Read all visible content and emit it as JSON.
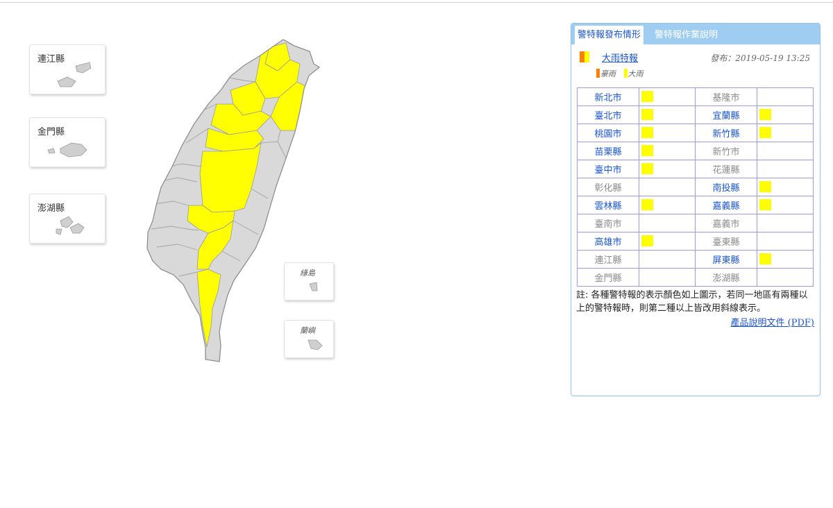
{
  "insets": [
    {
      "id": "lienchiang",
      "label": "連江縣"
    },
    {
      "id": "kinmen",
      "label": "金門縣"
    },
    {
      "id": "penghu",
      "label": "澎湖縣"
    },
    {
      "id": "green-island",
      "label": "綠島"
    },
    {
      "id": "orchid-island",
      "label": "蘭嶼"
    }
  ],
  "panel": {
    "tabs": [
      {
        "label": "警特報發布情形",
        "active": true
      },
      {
        "label": "警特報作業說明",
        "active": false
      }
    ],
    "warning_link": "大雨特報",
    "issued": "發布：2019-05-19 13:25",
    "legend": [
      {
        "label": "豪雨",
        "color": "#ff7f00"
      },
      {
        "label": "大雨",
        "color": "#ffff00"
      }
    ],
    "rows": [
      [
        {
          "name": "新北市",
          "warn": true
        },
        {
          "name": "基隆市",
          "warn": false
        }
      ],
      [
        {
          "name": "臺北市",
          "warn": true
        },
        {
          "name": "宜蘭縣",
          "warn": true
        }
      ],
      [
        {
          "name": "桃園市",
          "warn": true
        },
        {
          "name": "新竹縣",
          "warn": true
        }
      ],
      [
        {
          "name": "苗栗縣",
          "warn": true
        },
        {
          "name": "新竹市",
          "warn": false
        }
      ],
      [
        {
          "name": "臺中市",
          "warn": true
        },
        {
          "name": "花蓮縣",
          "warn": false
        }
      ],
      [
        {
          "name": "彰化縣",
          "warn": false
        },
        {
          "name": "南投縣",
          "warn": true
        }
      ],
      [
        {
          "name": "雲林縣",
          "warn": true
        },
        {
          "name": "嘉義縣",
          "warn": true
        }
      ],
      [
        {
          "name": "臺南市",
          "warn": false
        },
        {
          "name": "嘉義市",
          "warn": false
        }
      ],
      [
        {
          "name": "高雄市",
          "warn": true
        },
        {
          "name": "臺東縣",
          "warn": false
        }
      ],
      [
        {
          "name": "連江縣",
          "warn": false
        },
        {
          "name": "屏東縣",
          "warn": true
        }
      ],
      [
        {
          "name": "金門縣",
          "warn": false
        },
        {
          "name": "澎湖縣",
          "warn": false
        }
      ]
    ],
    "note": "註: 各種警特報的表示顏色如上圖示，若同一地區有兩種以上的警特報時，則第二種以上皆改用斜線表示。",
    "pdf_link": "產品說明文件 (PDF)"
  },
  "colors": {
    "heavy_rain": "#ffff00",
    "torrential_rain": "#ff7f00",
    "land": "#d9d9d9",
    "tab_bar": "#9fcdf1",
    "link": "#1c55c8"
  },
  "map_regions": [
    {
      "name": "新北市",
      "warn": true
    },
    {
      "name": "臺北市",
      "warn": true
    },
    {
      "name": "基隆市",
      "warn": false
    },
    {
      "name": "宜蘭縣",
      "warn": true
    },
    {
      "name": "桃園市",
      "warn": true
    },
    {
      "name": "新竹縣",
      "warn": true
    },
    {
      "name": "苗栗縣",
      "warn": true
    },
    {
      "name": "臺中市",
      "warn": true
    },
    {
      "name": "南投縣",
      "warn": true
    },
    {
      "name": "雲林縣",
      "warn": true
    },
    {
      "name": "嘉義縣",
      "warn": true
    },
    {
      "name": "高雄市",
      "warn": true
    },
    {
      "name": "屏東縣",
      "warn": true
    }
  ]
}
